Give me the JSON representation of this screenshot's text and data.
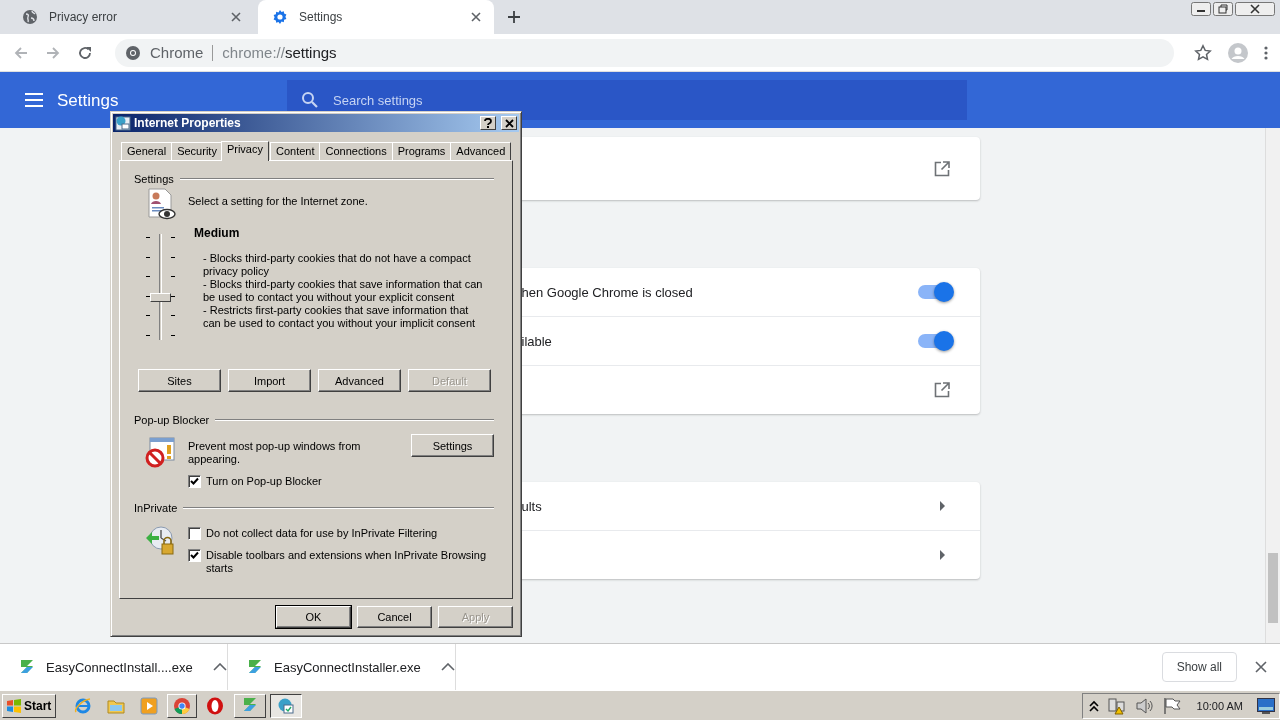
{
  "browser": {
    "tabs": [
      {
        "title": "Privacy error",
        "selected": false
      },
      {
        "title": "Settings",
        "selected": true
      }
    ],
    "omnibox": {
      "site": "Chrome",
      "url_scheme": "chrome://",
      "url_path": "settings"
    }
  },
  "settings_header": {
    "title": "Settings",
    "search_placeholder": "Search settings"
  },
  "cards": [
    {
      "rows": [
        {
          "kind": "link"
        }
      ]
    },
    {
      "rows": [
        {
          "kind": "toggle",
          "label": "hen Google Chrome is closed",
          "on": true
        },
        {
          "kind": "toggle",
          "label": "ilable",
          "on": true
        },
        {
          "kind": "link"
        }
      ]
    },
    {
      "rows": [
        {
          "kind": "arrow",
          "label": "ults"
        },
        {
          "kind": "arrow"
        }
      ]
    }
  ],
  "dialog": {
    "title": "Internet Properties",
    "tabs": [
      {
        "label": "General",
        "selected": false
      },
      {
        "label": "Security",
        "selected": false
      },
      {
        "label": "Privacy",
        "selected": true
      },
      {
        "label": "Content",
        "selected": false
      },
      {
        "label": "Connections",
        "selected": false
      },
      {
        "label": "Programs",
        "selected": false
      },
      {
        "label": "Advanced",
        "selected": false
      }
    ],
    "settings_group": {
      "label": "Settings",
      "intro": "Select a setting for the Internet zone.",
      "level_name": "Medium",
      "level": 0.4,
      "description": [
        "- Blocks third-party cookies that do not have a compact privacy policy",
        "- Blocks third-party cookies that save information that can be used to contact you without your explicit consent",
        "- Restricts first-party cookies that save information that can be used to contact you without your implicit consent"
      ],
      "buttons": [
        {
          "label": "Sites",
          "disabled": false
        },
        {
          "label": "Import",
          "disabled": false
        },
        {
          "label": "Advanced",
          "disabled": false
        },
        {
          "label": "Default",
          "disabled": true
        }
      ]
    },
    "popup_group": {
      "label": "Pop-up Blocker",
      "text": "Prevent most pop-up windows from appearing.",
      "button": "Settings",
      "checkbox": {
        "label": "Turn on Pop-up Blocker",
        "checked": true
      }
    },
    "inprivate_group": {
      "label": "InPrivate",
      "checkboxes": [
        {
          "label": "Do not collect data for use by InPrivate Filtering",
          "checked": false
        },
        {
          "label": "Disable toolbars and extensions when InPrivate Browsing starts",
          "checked": true
        }
      ]
    },
    "footer_buttons": [
      {
        "label": "OK",
        "default": true,
        "disabled": false
      },
      {
        "label": "Cancel",
        "default": false,
        "disabled": false
      },
      {
        "label": "Apply",
        "default": false,
        "disabled": true
      }
    ]
  },
  "downloads": {
    "items": [
      {
        "name": "EasyConnectInstall....exe"
      },
      {
        "name": "EasyConnectInstaller.exe"
      }
    ],
    "show_all": "Show all"
  },
  "taskbar": {
    "start": "Start",
    "tasks": [
      {
        "selected": false
      },
      {
        "selected": true
      }
    ],
    "clock": "10:00 AM"
  }
}
